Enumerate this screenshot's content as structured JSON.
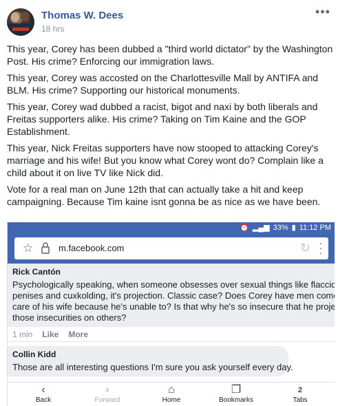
{
  "post": {
    "author": "Thomas W. Dees",
    "time": "18 hrs",
    "more_glyph": "•••",
    "paragraphs": [
      "This year, Corey has been dubbed a \"third world dictator\" by the Washington Post. His crime? Enforcing our immigration laws.",
      "This year, Corey was accosted on the Charlottesville Mall by ANTIFA and BLM. His crime? Supporting our historical monuments.",
      "This year, Corey wad dubbed a racist, bigot and naxi by both liberals and Freitas supporters alike. His crime? Taking on Tim Kaine and the GOP Establishment.",
      "This year, Nick Freitas supporters have now stooped to attacking Corey's marriage and his wife! But you know what Corey wont do? Complain like a child about it on live TV like Nick did.",
      "Vote for a real man on June 12th that can actually take a hit and keep campaigning. Because Tim kaine isnt gonna be as nice as we have been."
    ]
  },
  "screenshot": {
    "status": {
      "battery": "33%",
      "time": "11:12 PM"
    },
    "url": "m.facebook.com",
    "comments": [
      {
        "name": "Rick Cantón",
        "lines": [
          "Psychologically speaking, when someone obsesses over sexual things like flaccid",
          "penises and cuxkolding, it's projection. Classic case? Does Corey have men come tal",
          "care of his wife because he's unable to? Is that why he's so insecure that he projects",
          "those insecurities on others?"
        ],
        "time": "1 min",
        "like": "Like",
        "more": "More"
      },
      {
        "name": "Collin Kidd",
        "text": "Those are all interesting questions I'm sure you ask yourself every day."
      }
    ],
    "nav": {
      "back": "Back",
      "forward": "Forward",
      "home": "Home",
      "bookmarks": "Bookmarks",
      "tabs": "Tabs",
      "tabs_count": "2"
    }
  },
  "colors": {
    "link": "#365899",
    "facebook_blue": "#4267b2",
    "comment_bg": "#ebedf0"
  }
}
